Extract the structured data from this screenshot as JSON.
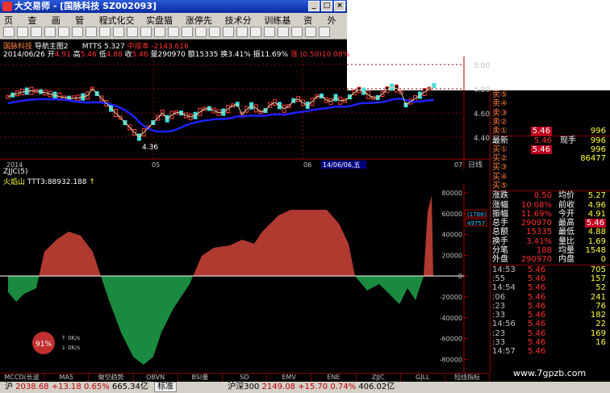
{
  "window": {
    "title": "大交易师 - [国脉科技  SZ002093]"
  },
  "menu": [
    "页面",
    "查看",
    "画面",
    "管理",
    "程式化交易",
    "实盘猫庄",
    "涨停先锋",
    "技术分析",
    "训练基地",
    "资讯",
    "外挂"
  ],
  "chart_header": {
    "stock": "国脉科技",
    "subtitle": "导航主图2",
    "mtts": "MTTS 5.327",
    "cost": "中成本",
    "cost_val": "-2143.616",
    "date": "2014/06/26",
    "open_l": "开",
    "open": "4.91",
    "high_l": "高",
    "high": "5.46",
    "low_l": "低",
    "low": "4.88",
    "close_l": "收",
    "close": "5.46",
    "vol": "量290970",
    "amt": "额15335",
    "turn": "换3.41%",
    "amp": "振11.69%",
    "chg": "涨 (0.50)10.08%"
  },
  "price_axis": [
    "5.00",
    "4.80",
    "4.60",
    "4.40"
  ],
  "date_axis": [
    "2014",
    "05",
    "06",
    "14/06/06,五",
    "07"
  ],
  "period": "日线",
  "low_mark": "4.36",
  "indicator": {
    "name": "ZJJC(5)",
    "line": "火焰山",
    "ttt": "TTT3:88932.188",
    "axis": [
      "80000",
      "60000",
      "40000",
      "20000",
      "0",
      "-20000",
      "-40000",
      "-60000",
      "-80000"
    ],
    "box1": "(1786)",
    "box2": "49757"
  },
  "badge": {
    "pct": "91%",
    "up": "0K/s",
    "down": "0K/s"
  },
  "quote": {
    "sells": [
      {
        "l": "卖⑤",
        "p": "",
        "v": ""
      },
      {
        "l": "卖④",
        "p": "",
        "v": ""
      },
      {
        "l": "卖③",
        "p": "",
        "v": ""
      },
      {
        "l": "卖②",
        "p": "",
        "v": ""
      },
      {
        "l": "卖①",
        "p": "5.46",
        "v": "996"
      }
    ],
    "last": {
      "l": "最新",
      "p": "5.46",
      "l2": "现手",
      "v": "996"
    },
    "buys": [
      {
        "l": "买①",
        "p": "5.46",
        "v": "996"
      },
      {
        "l": "买②",
        "p": "",
        "v": "86477"
      },
      {
        "l": "买③",
        "p": "",
        "v": ""
      },
      {
        "l": "买④",
        "p": "",
        "v": ""
      },
      {
        "l": "买⑤",
        "p": "",
        "v": ""
      }
    ],
    "stats": [
      {
        "a": "涨跌",
        "b": "0.50",
        "c": "均价",
        "d": "5.27"
      },
      {
        "a": "涨幅",
        "b": "10.08%",
        "c": "前收",
        "d": "4.96"
      },
      {
        "a": "振幅",
        "b": "11.69%",
        "c": "今开",
        "d": "4.91"
      },
      {
        "a": "总手",
        "b": "290970",
        "c": "最高",
        "d": "5.46"
      },
      {
        "a": "总额",
        "b": "15335",
        "c": "最低",
        "d": "4.88"
      },
      {
        "a": "换手",
        "b": "3.41%",
        "c": "量比",
        "d": "1.69"
      },
      {
        "a": "分笔",
        "b": "188",
        "c": "均量",
        "d": "1548"
      },
      {
        "a": "外盘",
        "b": "290970",
        "c": "内盘",
        "d": "0"
      }
    ],
    "ticks": [
      {
        "t": "14:53",
        "p": "5.46",
        "v": "705"
      },
      {
        "t": ":55",
        "p": "5.46",
        "v": "157"
      },
      {
        "t": "14:54",
        "p": "5.46",
        "v": "52"
      },
      {
        "t": ":06",
        "p": "5.46",
        "v": "241"
      },
      {
        "t": ":23",
        "p": "5.46",
        "v": "76"
      },
      {
        "t": ":33",
        "p": "5.46",
        "v": "182"
      },
      {
        "t": "14:56",
        "p": "5.46",
        "v": "22"
      },
      {
        "t": ":23",
        "p": "5.46",
        "v": "169"
      },
      {
        "t": ":33",
        "p": "5.46",
        "v": "16"
      },
      {
        "t": "14:57",
        "p": "5.46",
        "v": ""
      }
    ]
  },
  "tabs": [
    "MCCD(长波",
    "MA5",
    "做空趋势",
    "OBVN",
    "BSI量",
    "SD",
    "EMV",
    "ENE",
    "ZJJC",
    "GJLL",
    "短线指标"
  ],
  "status": {
    "sh": "沪",
    "sh_val": "2038.68",
    "sh_chg": "+13.18",
    "sh_pct": "0.65%",
    "sh_amt": "665.34亿",
    "mode": "标准",
    "hs": "沪深300",
    "hs_val": "2149.08",
    "hs_chg": "+15.70",
    "hs_pct": "0.74%",
    "hs_amt": "406.02亿"
  },
  "watermark": "www.7gpzb.com"
}
